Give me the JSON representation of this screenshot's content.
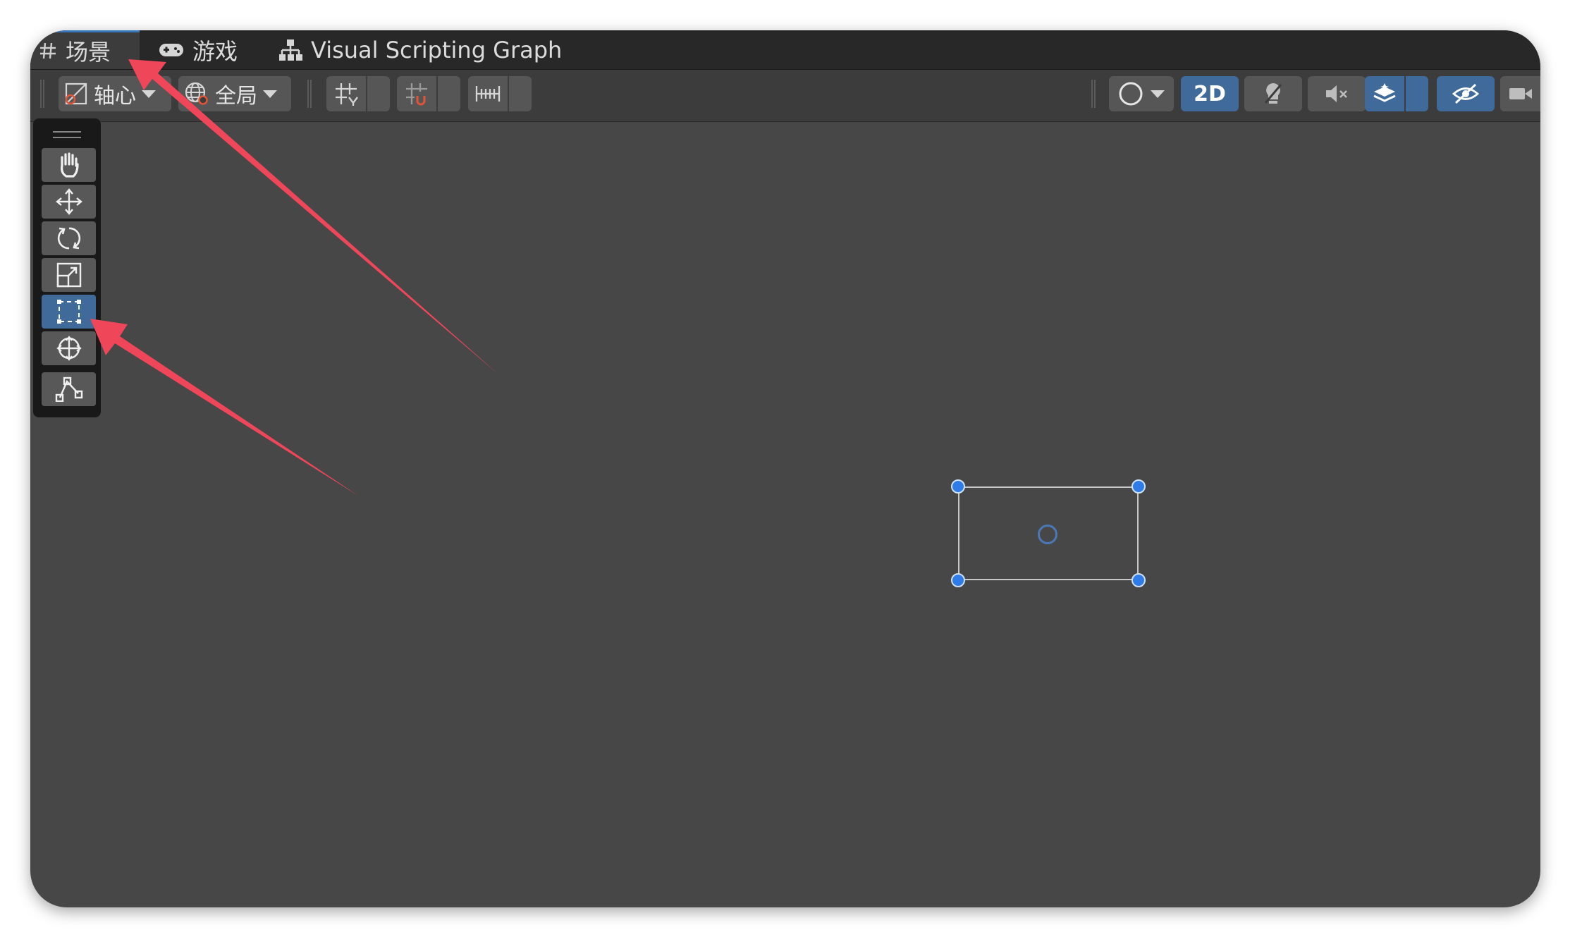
{
  "tabs": [
    {
      "label": "场景",
      "icon": "hash-icon",
      "active": true
    },
    {
      "label": "游戏",
      "icon": "gamepad-icon",
      "active": false
    },
    {
      "label": "Visual Scripting Graph",
      "icon": "graph-tree-icon",
      "active": false
    }
  ],
  "toolbar": {
    "pivot_label": "轴心",
    "global_label": "全局",
    "mode_2d_label": "2D"
  },
  "tools": [
    {
      "name": "hand-tool",
      "icon": "hand-icon"
    },
    {
      "name": "move-tool",
      "icon": "move-arrows-icon"
    },
    {
      "name": "rotate-tool",
      "icon": "rotate-icon"
    },
    {
      "name": "scale-tool",
      "icon": "scale-icon"
    },
    {
      "name": "rect-tool",
      "icon": "rect-transform-icon",
      "selected": true
    },
    {
      "name": "transform-tool",
      "icon": "transform-icon"
    },
    {
      "name": "custom-editor-tool",
      "icon": "path-edit-icon"
    }
  ],
  "colors": {
    "accent": "#3f6a9a",
    "annotation_arrow": "#f0465a",
    "handle": "#2f7be8",
    "scene_bg": "#474747"
  }
}
